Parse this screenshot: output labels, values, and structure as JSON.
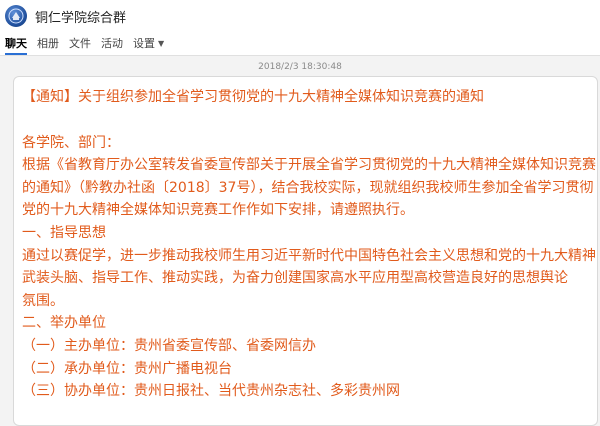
{
  "window": {
    "group_name": "铜仁学院综合群",
    "avatar_icon": "school-emblem-icon"
  },
  "tabs": [
    {
      "label": "聊天",
      "active": true
    },
    {
      "label": "相册",
      "active": false
    },
    {
      "label": "文件",
      "active": false
    },
    {
      "label": "活动",
      "active": false
    },
    {
      "label": "设置",
      "active": false,
      "has_dropdown": true
    }
  ],
  "message": {
    "timestamp": "2018/2/3 18:30:48",
    "title": "【通知】关于组织参加全省学习贯彻党的十九大精神全媒体知识竞赛的通知",
    "lines": [
      "各学院、部门：",
      "根据《省教育厅办公室转发省委宣传部关于开展全省学习贯彻党的十九大精神全媒体知识竞赛",
      "的通知》（黔教办社函〔2018〕37号），结合我校实际，现就组织我校师生参加全省学习贯彻",
      "党的十九大精神全媒体知识竞赛工作作如下安排，请遵照执行。",
      "一、指导思想",
      "通过以赛促学，进一步推动我校师生用习近平新时代中国特色社会主义思想和党的十九大精神",
      "武装头脑、指导工作、推动实践，为奋力创建国家高水平应用型高校营造良好的思想舆论",
      "氛围。",
      "二、举办单位",
      "（一）主办单位：贵州省委宣传部、省委网信办",
      "（二）承办单位：贵州广播电视台",
      "（三）协办单位：贵州日报社、当代贵州杂志社、多彩贵州网"
    ]
  },
  "colors": {
    "message_text": "#e15b1c",
    "accent": "#2a6fd4"
  }
}
